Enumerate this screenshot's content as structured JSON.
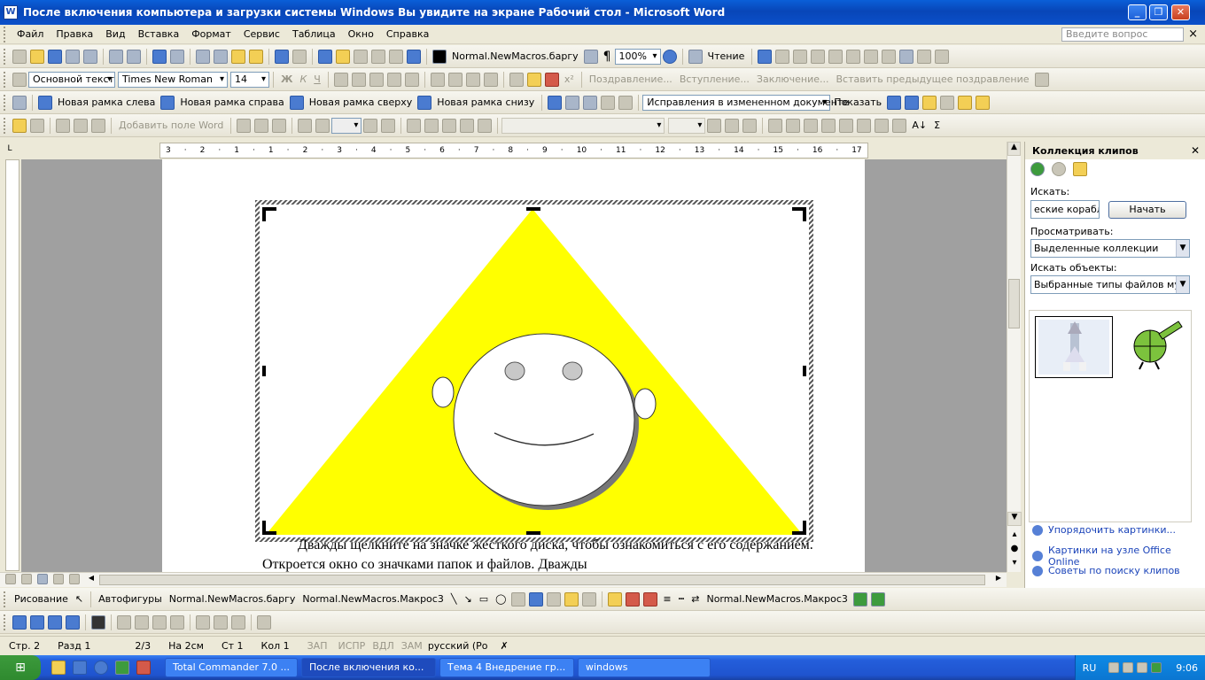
{
  "window": {
    "title": "После включения компьютера и загрузки системы Windows Вы увидите на экране Рабочий стол - Microsoft Word",
    "icon": "word-icon",
    "buttons": [
      "minimize-icon",
      "restore-icon",
      "close-icon"
    ]
  },
  "menu": {
    "items": [
      "Файл",
      "Правка",
      "Вид",
      "Вставка",
      "Формат",
      "Сервис",
      "Таблица",
      "Окно",
      "Справка"
    ],
    "ask_placeholder": "Введите вопрос",
    "close": "×"
  },
  "toolbar1": {
    "macro": "Normal.NewMacros.баргу",
    "zoom": "100%",
    "reading": "Чтение"
  },
  "toolbar2": {
    "style": "Основной текст",
    "font": "Times New Roman",
    "size": "14",
    "bold": "Ж",
    "italic": "К",
    "underline": "Ч",
    "mail1": "Поздравление...",
    "mail2": "Вступление...",
    "mail3": "Заключение...",
    "mail4": "Вставить предыдущее поздравление"
  },
  "toolbar3": {
    "frame_left": "Новая рамка слева",
    "frame_right": "Новая рамка справа",
    "frame_top": "Новая рамка сверху",
    "frame_bottom": "Новая рамка снизу",
    "review_mode": "Исправления в измененном документе",
    "show": "Показать"
  },
  "toolbar4": {
    "add_field": "Добавить поле Word"
  },
  "ruler": {
    "labels": [
      "3",
      "·",
      "2",
      "·",
      "1",
      "·",
      "1",
      "·",
      "2",
      "·",
      "3",
      "·",
      "4",
      "·",
      "5",
      "·",
      "6",
      "·",
      "7",
      "·",
      "8",
      "·",
      "9",
      "·",
      "10",
      "·",
      "11",
      "·",
      "12",
      "·",
      "13",
      "·",
      "14",
      "·",
      "15",
      "·",
      "16",
      "·",
      "17"
    ]
  },
  "document": {
    "text": "Дважды щелкните на значке жесткого диска, чтобы ознакомиться с его содержанием. Откроется окно со значками папок и файлов. Дважды"
  },
  "taskpane": {
    "title": "Коллекция клипов",
    "search_label": "Искать:",
    "search_value": "еские корабли",
    "search_button": "Начать",
    "browse_label": "Просматривать:",
    "browse_value": "Выделенные коллекции",
    "objects_label": "Искать объекты:",
    "objects_value": "Выбранные типы файлов мульт",
    "links": [
      "Упорядочить картинки...",
      "Картинки на узле Office Online",
      "Советы по поиску клипов"
    ]
  },
  "drawbar": {
    "drawing": "Рисование",
    "autoshapes": "Автофигуры",
    "macro1": "Normal.NewMacros.баргу",
    "macro2": "Normal.NewMacros.Макрос3",
    "macro3": "Normal.NewMacros.Макрос3"
  },
  "status": {
    "page": "Стр. 2",
    "section": "Разд 1",
    "pages": "2/3",
    "at": "На 2см",
    "line": "Ст 1",
    "col": "Кол 1",
    "rec": "ЗАП",
    "trk": "ИСПР",
    "ext": "ВДЛ",
    "ovr": "ЗАМ",
    "lang": "русский (Ро"
  },
  "taskbar": {
    "start": "start",
    "items": [
      "Total Commander 7.0 ...",
      "После включения ко...",
      "Тема 4 Внедрение гр...",
      "windows"
    ],
    "active": 1,
    "lang": "RU",
    "time": "9:06"
  }
}
